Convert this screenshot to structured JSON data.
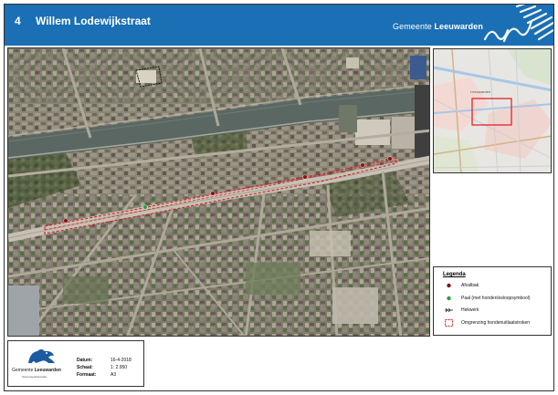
{
  "header": {
    "map_number": "4",
    "title": "Willem Lodewijkstraat",
    "brand_prefix": "Gemeente",
    "brand_name": "Leeuwarden",
    "background_color": "#1a6fb5"
  },
  "overview_map": {
    "place_label": "Leeuwarden",
    "extent_color": "#e0141e"
  },
  "legend": {
    "title": "Legenda",
    "items": [
      {
        "label": "Afvalbak",
        "symbol": "dark-red-dot",
        "color": "#8b1010"
      },
      {
        "label": "Paal (met hondenlosloopsymbool)",
        "symbol": "green-dot",
        "color": "#2e9e3a"
      },
      {
        "label": "Hekwerk",
        "symbol": "fence-line",
        "color": "#111111"
      },
      {
        "label": "Omgrenzing hondenuitlaatstroken",
        "symbol": "red-dashed-box",
        "color": "#e0141e"
      }
    ]
  },
  "titleblock": {
    "logo_text_prefix": "Gemeente",
    "logo_text_name": "Leeuwarden",
    "logo_subtext": "Team Geoinformatie",
    "fields": [
      {
        "label": "Datum:",
        "value": "16-4-2018"
      },
      {
        "label": "Schaal:",
        "value": "1: 2.950"
      },
      {
        "label": "Formaat:",
        "value": "A3"
      }
    ]
  },
  "map_markers": {
    "afvalbak_count": 5,
    "paal_count": 1
  }
}
